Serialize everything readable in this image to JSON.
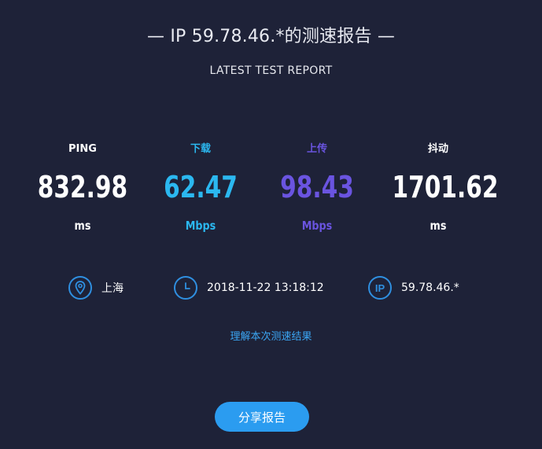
{
  "header": {
    "title": "— IP 59.78.46.*的测速报告 —",
    "subtitle": "LATEST TEST REPORT"
  },
  "metrics": [
    {
      "label": "PING",
      "value": "832.98",
      "unit": "ms",
      "color": "#ffffff"
    },
    {
      "label": "下载",
      "value": "62.47",
      "unit": "Mbps",
      "color": "#2bb8f0"
    },
    {
      "label": "上传",
      "value": "98.43",
      "unit": "Mbps",
      "color": "#6a54e0"
    },
    {
      "label": "抖动",
      "value": "1701.62",
      "unit": "ms",
      "color": "#ffffff"
    }
  ],
  "info": {
    "location": {
      "icon": "location-pin-icon",
      "text": "上海"
    },
    "time": {
      "icon": "clock-icon",
      "text": "2018-11-22 13:18:12"
    },
    "ip": {
      "icon": "ip-icon",
      "icon_text": "IP",
      "text": "59.78.46.*"
    }
  },
  "link": {
    "text": "理解本次测速结果"
  },
  "share_button": {
    "label": "分享报告"
  },
  "colors": {
    "background": "#1e2238",
    "accent": "#2b9cf0",
    "download": "#2bb8f0",
    "upload": "#6a54e0"
  }
}
